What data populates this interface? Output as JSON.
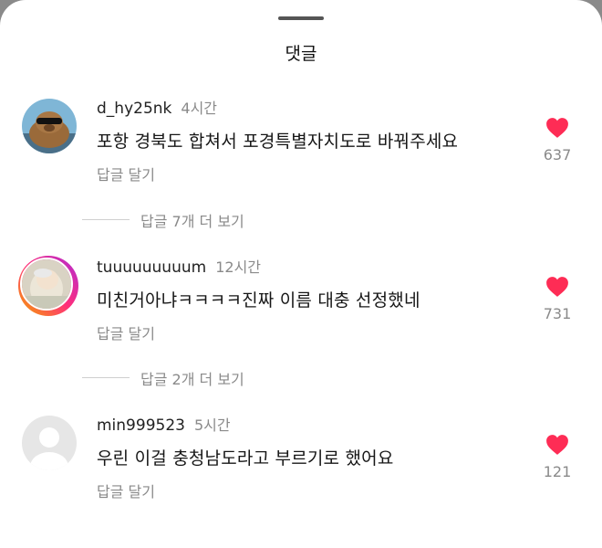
{
  "header": {
    "title": "댓글"
  },
  "comments": [
    {
      "username": "d_hy25nk",
      "time": "4시간",
      "text": "포항 경북도 합쳐서 포경특별자치도로 바꿔주세요",
      "reply_label": "답글 달기",
      "like_count": "637",
      "like_color": "#fe2c55",
      "more_replies": "답글 7개 더 보기"
    },
    {
      "username": "tuuuuuuuuum",
      "time": "12시간",
      "text": "미친거아냐ㅋㅋㅋㅋ진짜 이름 대충 선정했네",
      "reply_label": "답글 달기",
      "like_count": "731",
      "like_color": "#fe2c55",
      "more_replies": "답글 2개 더 보기"
    },
    {
      "username": "min999523",
      "time": "5시간",
      "text": "우린 이걸 충청남도라고 부르기로 했어요",
      "reply_label": "답글 달기",
      "like_count": "121",
      "like_color": "#fe2c55"
    }
  ]
}
